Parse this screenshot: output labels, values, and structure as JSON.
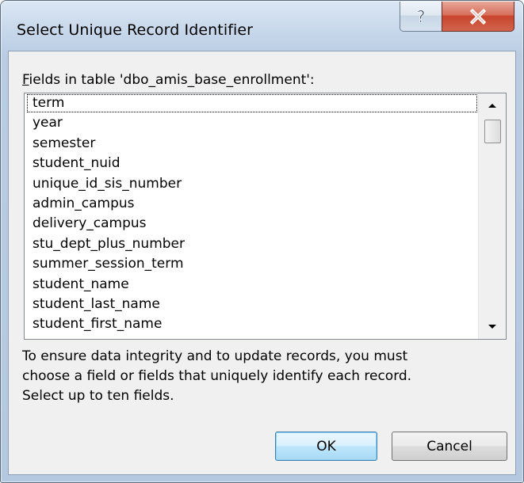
{
  "window": {
    "title": "Select Unique Record Identifier",
    "help_label": "?",
    "close_label": "X"
  },
  "fields_label": {
    "accel": "F",
    "rest": "ields in table 'dbo_amis_base_enrollment':"
  },
  "fields": [
    "term",
    "year",
    "semester",
    "student_nuid",
    "unique_id_sis_number",
    "admin_campus",
    "delivery_campus",
    "stu_dept_plus_number",
    "summer_session_term",
    "student_name",
    "student_last_name",
    "student_first_name"
  ],
  "info_lines": [
    "To ensure data integrity and to update records, you must",
    "choose a field or fields that uniquely identify each record.",
    "Select up to ten fields."
  ],
  "buttons": {
    "ok": "OK",
    "cancel": "Cancel"
  },
  "icons": {
    "help": "help-icon",
    "close": "close-icon",
    "scroll_up": "scroll-up-arrow-icon",
    "scroll_down": "scroll-down-arrow-icon"
  }
}
